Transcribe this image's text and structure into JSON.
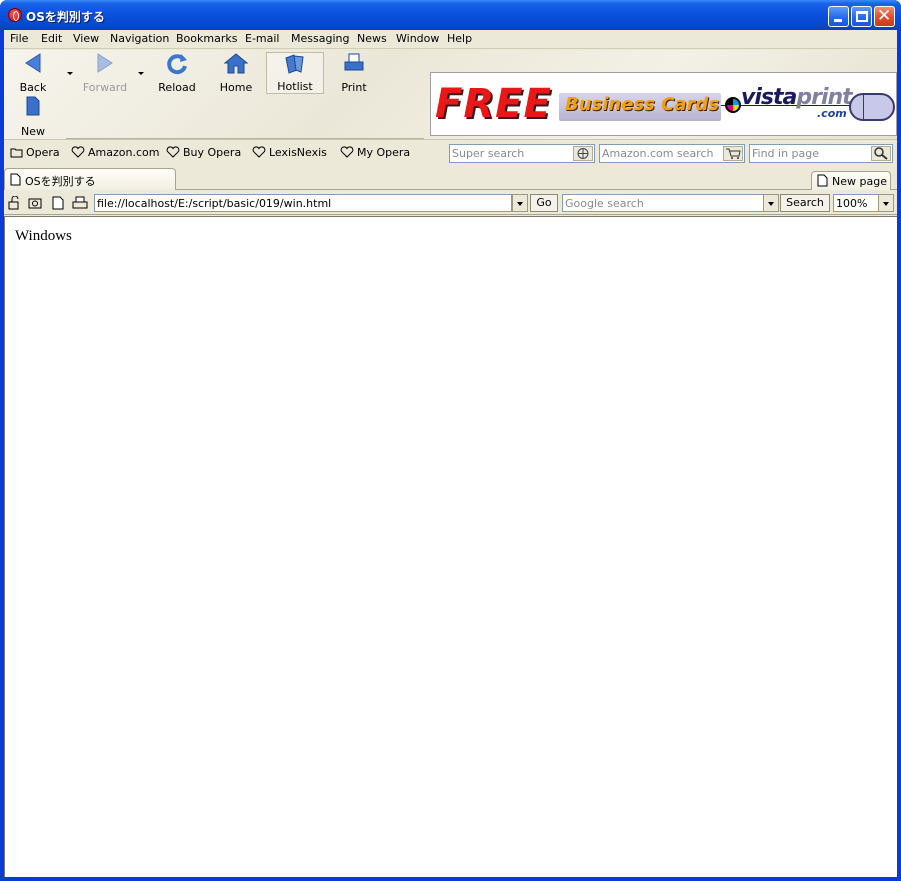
{
  "window": {
    "title": "OSを判別する"
  },
  "menu": {
    "items": [
      "File",
      "Edit",
      "View",
      "Navigation",
      "Bookmarks",
      "E-mail",
      "Messaging",
      "News",
      "Window",
      "Help"
    ]
  },
  "toolbar": {
    "back": "Back",
    "forward": "Forward",
    "reload": "Reload",
    "home": "Home",
    "hotlist": "Hotlist",
    "print": "Print",
    "new": "New"
  },
  "banner": {
    "free": "FREE",
    "business_cards": "Business Cards",
    "vista": "vista",
    "print": "print",
    "com": ".com"
  },
  "bookmarks": {
    "items": [
      "Opera",
      "Amazon.com",
      "Buy Opera",
      "LexisNexis",
      "My Opera"
    ],
    "super_search_placeholder": "Super search",
    "amazon_search_placeholder": "Amazon.com search",
    "find_placeholder": "Find in page"
  },
  "tabs": {
    "active": "OSを判別する",
    "new_page": "New page"
  },
  "address": {
    "url": "file://localhost/E:/script/basic/019/win.html",
    "go": "Go",
    "google_placeholder": "Google search",
    "search": "Search",
    "zoom": "100%"
  },
  "page": {
    "body_text": "Windows"
  },
  "colors": {
    "titlebar": "#0a50dc",
    "chrome": "#ece9d8",
    "banner_red": "#e81818",
    "banner_orange": "#f0a010"
  }
}
